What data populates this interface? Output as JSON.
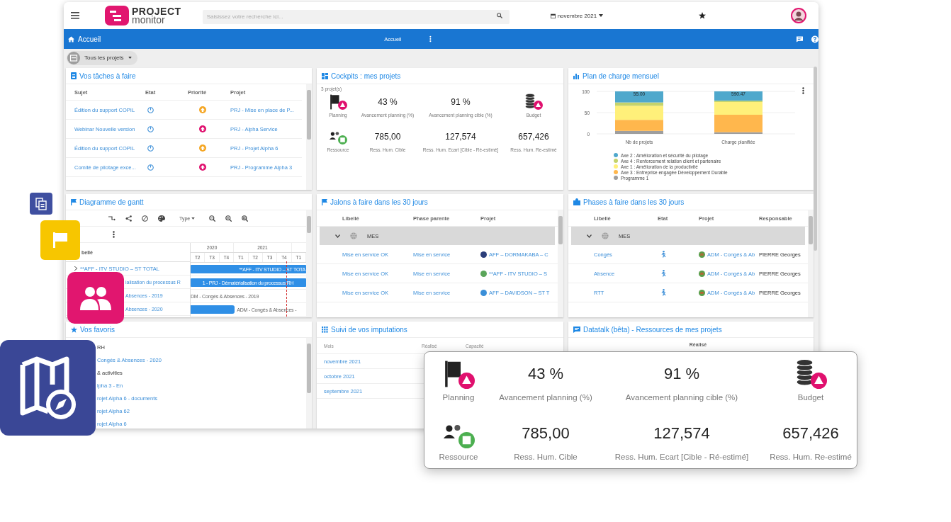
{
  "header": {
    "logo": {
      "line1": "PROJECT",
      "line2": "monitor"
    },
    "search": {
      "placeholder": "Saisissez votre recherche ici..."
    },
    "period": "novembre 2021"
  },
  "navbar": {
    "title": "Accueil",
    "center": "Accueil"
  },
  "filter": {
    "label": "Tous les projets"
  },
  "tasks": {
    "title": "Vos tâches à faire",
    "columns": [
      "Sujet",
      "Etat",
      "Priorité",
      "Projet"
    ],
    "rows": [
      {
        "subject": "Édition du support COPIL",
        "color": "#f5a623",
        "project": "PRJ - Mise en place de P..."
      },
      {
        "subject": "Webinar Nouvelle version",
        "color": "#e0106e",
        "project": "PRJ - Alpha Service"
      },
      {
        "subject": "Édition du support COPIL",
        "color": "#f5a623",
        "project": "PRJ - Projet Alpha 6"
      },
      {
        "subject": "Comité de pilotage exce...",
        "color": "#e0106e",
        "project": "PRJ - Programme Alpha 3"
      }
    ]
  },
  "cockpits": {
    "title": "Cockpits : mes projets",
    "count": "3 projet(s)",
    "metrics": [
      {
        "kind": "planning",
        "color": "#e0106e",
        "label": "Planning"
      },
      {
        "kind": "value",
        "value": "43 %",
        "label": "Avancement planning (%)"
      },
      {
        "kind": "value",
        "value": "91 %",
        "label": "Avancement planning cible (%)"
      },
      {
        "kind": "budget",
        "color": "#e0106e",
        "label": "Budget"
      },
      {
        "kind": "resource",
        "color": "#4caf50",
        "label": "Ressource"
      },
      {
        "kind": "value",
        "value": "785,00",
        "label": "Ress. Hum. Cible"
      },
      {
        "kind": "value",
        "value": "127,574",
        "label": "Ress. Hum. Ecart [Cible - Ré-estimé]"
      },
      {
        "kind": "value",
        "value": "657,426",
        "label": "Ress. Hum. Re-estimé"
      }
    ]
  },
  "charge_plan": {
    "title": "Plan de charge mensuel",
    "chart_data": {
      "type": "bar",
      "stacked": true,
      "categories": [
        "Nb de projets",
        "Charge planifiée"
      ],
      "ylim": [
        0,
        100
      ],
      "yticks": [
        0,
        50,
        100
      ],
      "value_labels": [
        "55.00",
        "590.47"
      ],
      "series": [
        {
          "name": "Axe 2 : Amélioration et sécurité du pilotage",
          "color": "#4fa8cc",
          "values": [
            26,
            22
          ]
        },
        {
          "name": "Axe 4 : Renforcement relation client et partenaire",
          "color": "#c5d36b",
          "values": [
            8,
            3
          ]
        },
        {
          "name": "Axe 1 : Amélioration de la productivité",
          "color": "#fff07a",
          "values": [
            33,
            30
          ]
        },
        {
          "name": "Axe 3 : Entreprise engagée Développement Durable",
          "color": "#ffb74d",
          "values": [
            26,
            41
          ]
        },
        {
          "name": "Programme 1",
          "color": "#9e9e9e",
          "values": [
            7,
            4
          ]
        }
      ]
    }
  },
  "gantt": {
    "title": "Diagramme de gantt",
    "type_menu": "Type",
    "label_header": "bellé",
    "years": [
      "2020",
      "2021"
    ],
    "quarters": [
      "T2",
      "T3",
      "T4",
      "T1",
      "T2",
      "T3",
      "T4",
      "T1"
    ],
    "rows": [
      {
        "kind": "group",
        "label": "**AFF - ITV STUDIO – ST TOTAL",
        "bar": {
          "kind": "full",
          "label": "**AFF - ITV STUDIO – ST TOTA"
        }
      },
      {
        "kind": "task",
        "label": "ialisation du processus R",
        "bar": {
          "kind": "full",
          "label": "1 - PRJ - Dématérialisation du processus RH"
        }
      },
      {
        "kind": "task",
        "label": "Absences - 2019",
        "bar": {
          "kind": "none",
          "label": "DM - Congés & Absences - 2019"
        }
      },
      {
        "kind": "task",
        "label": "Absences - 2020",
        "bar": {
          "kind": "start",
          "label": "ADM - Congés & Absences -"
        }
      }
    ]
  },
  "milestones": {
    "title": "Jalons à faire dans les 30 jours",
    "columns": [
      "Libellé",
      "Phase parente",
      "Projet"
    ],
    "group": {
      "label": "MES",
      "expanded": true
    },
    "rows": [
      {
        "label": "Mise en service OK",
        "phase": "Mise en service",
        "project": "AFF – DORMAKABA – C",
        "color": "#2c3e7a"
      },
      {
        "label": "Mise en service OK",
        "phase": "Mise en service",
        "project": "**AFF - ITV STUDIO – S",
        "color": "#5aa55a"
      },
      {
        "label": "Mise en service OK",
        "phase": "Mise en service",
        "project": "AFF – DAVIDSON – ST T",
        "color": "#3a8fd8"
      }
    ]
  },
  "phases": {
    "title": "Phases à faire dans les 30 jours",
    "columns": [
      "Libellé",
      "Etat",
      "Projet",
      "Responsable"
    ],
    "group": {
      "label": "MES",
      "expanded": true
    },
    "rows": [
      {
        "label": "Congés",
        "project": "ADM - Congés & Ab",
        "owner": "PIERRE Georges"
      },
      {
        "label": "Absence",
        "project": "ADM - Congés & Ab",
        "owner": "PIERRE Georges"
      },
      {
        "label": "RTT",
        "project": "ADM - Congés & Ab",
        "owner": "PIERRE Georges"
      }
    ]
  },
  "favorites": {
    "title": "Vos favoris",
    "items": [
      {
        "kind": "folder",
        "label": "RH"
      },
      {
        "kind": "link",
        "label": "Congés & Absences - 2020"
      },
      {
        "kind": "folder",
        "label": "& activities"
      },
      {
        "kind": "link",
        "label": "lpha 3 - En"
      },
      {
        "kind": "link",
        "label": "rojet Alpha 6 - documents"
      },
      {
        "kind": "link",
        "label": "rojet Alpha 62"
      },
      {
        "kind": "link",
        "label": "rojet Alpha 6"
      }
    ]
  },
  "time_tracking": {
    "title": "Suivi de vos imputations",
    "columns": [
      "Mois",
      "Réalisé",
      "Capacité"
    ],
    "rows": [
      "novembre 2021",
      "octobre 2021",
      "septembre 2021"
    ]
  },
  "datatalk": {
    "title": "Datatalk (bêta) - Ressources de mes projets",
    "column": "Réalisé"
  },
  "cockpit_popup": {
    "metrics": [
      {
        "kind": "planning",
        "color": "#e0106e",
        "label": "Planning"
      },
      {
        "kind": "value",
        "value": "43 %",
        "label": "Avancement planning (%)"
      },
      {
        "kind": "value",
        "value": "91 %",
        "label": "Avancement planning cible (%)"
      },
      {
        "kind": "budget",
        "color": "#e0106e",
        "label": "Budget"
      },
      {
        "kind": "resource",
        "color": "#4caf50",
        "label": "Ressource"
      },
      {
        "kind": "value",
        "value": "785,00",
        "label": "Ress. Hum. Cible"
      },
      {
        "kind": "value",
        "value": "127,574",
        "label": "Ress. Hum. Ecart [Cible - Ré-estimé]"
      },
      {
        "kind": "value",
        "value": "657,426",
        "label": "Ress. Hum. Re-estimé"
      }
    ]
  }
}
